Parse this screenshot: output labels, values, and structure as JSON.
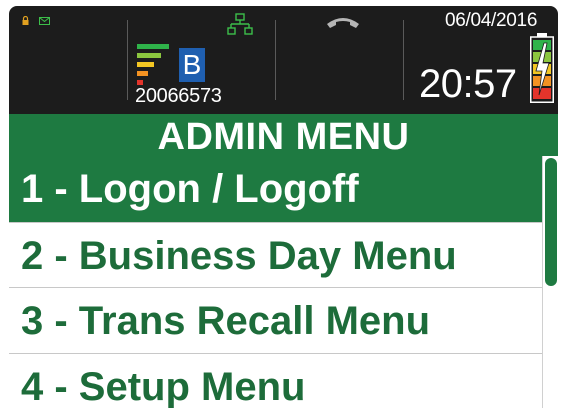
{
  "status_bar": {
    "terminal_id": "20066573",
    "mode_badge": "B",
    "date": "06/04/2016",
    "time": "20:57",
    "icons": [
      "lock-icon",
      "mail-icon",
      "network-icon",
      "phone-icon",
      "signal-icon",
      "battery-icon"
    ]
  },
  "menu": {
    "title": "ADMIN MENU",
    "items": [
      {
        "label": "1 - Logon / Logoff",
        "selected": true
      },
      {
        "label": "2 - Business Day Menu",
        "selected": false
      },
      {
        "label": "3 - Trans Recall Menu",
        "selected": false
      },
      {
        "label": "4 - Setup Menu",
        "selected": false
      }
    ]
  },
  "colors": {
    "header_background": "#1c1c1c",
    "accent_green": "#1e7a41",
    "menu_text_green": "#1d6c3a",
    "mode_badge_blue": "#1f5fb0"
  }
}
